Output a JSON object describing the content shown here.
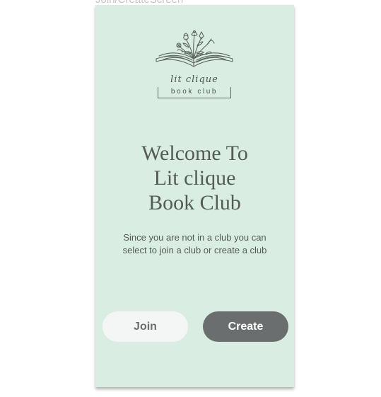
{
  "frame": {
    "caption": "Join/CreateScreen"
  },
  "logo": {
    "script_text": "lit clique",
    "sub_text": "book club"
  },
  "welcome": {
    "line1": "Welcome To",
    "line2": "Lit clique",
    "line3": "Book Club"
  },
  "subtitle": "Since you are not in a club you can select to join a club or create a club",
  "buttons": {
    "join_label": "Join",
    "create_label": "Create"
  },
  "colors": {
    "background": "#d9ede3",
    "join_button": "#f4f6f5",
    "create_button": "#6b6e6f",
    "text": "#545b57"
  }
}
